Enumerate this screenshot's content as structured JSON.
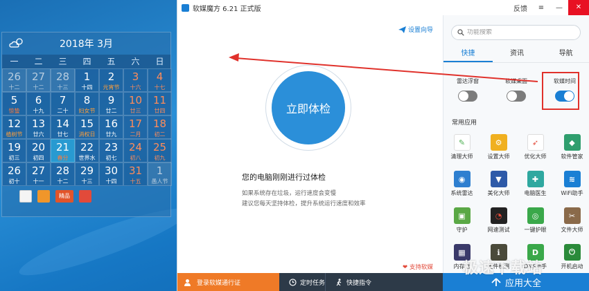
{
  "calendar": {
    "title": "2018年 3月",
    "weekdays": [
      "一",
      "二",
      "三",
      "四",
      "五",
      "六",
      "日"
    ],
    "days": [
      {
        "n": "26",
        "l": "十二",
        "dim": true
      },
      {
        "n": "27",
        "l": "十二",
        "dim": true
      },
      {
        "n": "28",
        "l": "十三",
        "dim": true
      },
      {
        "n": "1",
        "l": "十四"
      },
      {
        "n": "2",
        "l": "元宵节",
        "fest": true
      },
      {
        "n": "3",
        "l": "十六",
        "hol": true
      },
      {
        "n": "4",
        "l": "十七",
        "hol": true
      },
      {
        "n": "5",
        "l": "惊蛰",
        "fest2": true
      },
      {
        "n": "6",
        "l": "十九"
      },
      {
        "n": "7",
        "l": "二十"
      },
      {
        "n": "8",
        "l": "妇女节",
        "fest": true
      },
      {
        "n": "9",
        "l": "廿二"
      },
      {
        "n": "10",
        "l": "廿三",
        "hol": true
      },
      {
        "n": "11",
        "l": "廿四",
        "hol": true
      },
      {
        "n": "12",
        "l": "植树节",
        "fest": true
      },
      {
        "n": "13",
        "l": "廿六"
      },
      {
        "n": "14",
        "l": "廿七"
      },
      {
        "n": "15",
        "l": "消权日",
        "fest": true
      },
      {
        "n": "16",
        "l": "廿九"
      },
      {
        "n": "17",
        "l": "二月",
        "hol": true
      },
      {
        "n": "18",
        "l": "初二",
        "hol": true
      },
      {
        "n": "19",
        "l": "初三"
      },
      {
        "n": "20",
        "l": "初四"
      },
      {
        "n": "21",
        "l": "春分",
        "fest2": true,
        "today": true
      },
      {
        "n": "22",
        "l": "世界水"
      },
      {
        "n": "23",
        "l": "初七"
      },
      {
        "n": "24",
        "l": "初八",
        "hol": true
      },
      {
        "n": "25",
        "l": "初九",
        "hol": true
      },
      {
        "n": "26",
        "l": "初十"
      },
      {
        "n": "27",
        "l": "十一"
      },
      {
        "n": "28",
        "l": "十二"
      },
      {
        "n": "29",
        "l": "十三"
      },
      {
        "n": "30",
        "l": "十四"
      },
      {
        "n": "31",
        "l": "十五",
        "hol": true
      },
      {
        "n": "1",
        "l": "愚人节",
        "dim": true
      }
    ],
    "tools": [
      "notes-icon",
      "calendar-book-icon",
      "gift-icon",
      "toolbox-icon"
    ],
    "tool_badge": "精品"
  },
  "window": {
    "title": "软媒魔方 6.21 正式版",
    "feedback": "反馈",
    "menu_icon": "≡",
    "min_icon": "—",
    "close_icon": "✕"
  },
  "main": {
    "guide": "设置向导",
    "check_button": "立即体检",
    "msg_title": "您的电脑刚刚进行过体检",
    "msg1": "如果系统存在垃圾，运行速度会变慢",
    "msg2": "建议您每天坚持体检，提升系统运行速度和效率",
    "support": "支持软媒"
  },
  "side": {
    "search_placeholder": "功能搜索",
    "tabs": [
      "快捷",
      "资讯",
      "导航"
    ],
    "toggles": [
      {
        "label": "雷达浮窗",
        "on": false
      },
      {
        "label": "软媒桌面",
        "on": false
      },
      {
        "label": "软媒时间",
        "on": true
      }
    ],
    "apps_title": "常用应用",
    "apps": [
      {
        "label": "清理大师",
        "icon": "broom-icon",
        "color": "#ffffff",
        "fg": "#4caf50",
        "glyph": "✎"
      },
      {
        "label": "设置大师",
        "icon": "settings-gear-icon",
        "color": "#f0b020",
        "fg": "#fff",
        "glyph": "⚙"
      },
      {
        "label": "优化大师",
        "icon": "rocket-icon",
        "color": "#ffffff",
        "fg": "#e24a3a",
        "glyph": "➶"
      },
      {
        "label": "软件管家",
        "icon": "software-manager-icon",
        "color": "#2f9e6e",
        "fg": "#fff",
        "glyph": "◆"
      },
      {
        "label": "系统雷达",
        "icon": "radar-icon",
        "color": "#2e7fd0",
        "fg": "#fff",
        "glyph": "◉"
      },
      {
        "label": "美化大师",
        "icon": "tshirt-icon",
        "color": "#2e5aa8",
        "fg": "#fff",
        "glyph": "▼"
      },
      {
        "label": "电脑医生",
        "icon": "medical-kit-icon",
        "color": "#2fa8a0",
        "fg": "#fff",
        "glyph": "✚"
      },
      {
        "label": "WiFi助手",
        "icon": "wifi-icon",
        "color": "#1a7fd4",
        "fg": "#fff",
        "glyph": "≋"
      },
      {
        "label": "守护",
        "icon": "shield-icon",
        "color": "#5aa845",
        "fg": "#fff",
        "glyph": "▣"
      },
      {
        "label": "网速测试",
        "icon": "speedometer-icon",
        "color": "#222222",
        "fg": "#e24a3a",
        "glyph": "◔"
      },
      {
        "label": "一键护眼",
        "icon": "eye-icon",
        "color": "#3aa84a",
        "fg": "#fff",
        "glyph": "◎"
      },
      {
        "label": "文件大师",
        "icon": "file-master-icon",
        "color": "#8a6a4a",
        "fg": "#fff",
        "glyph": "✂"
      },
      {
        "label": "内存盘",
        "icon": "memory-chip-icon",
        "color": "#3a3a6a",
        "fg": "#fff",
        "glyph": "▦"
      },
      {
        "label": "硬件检测",
        "icon": "hardware-icon",
        "color": "#4a4a3a",
        "fg": "#fff",
        "glyph": "ℹ"
      },
      {
        "label": "DNS助手",
        "icon": "dns-icon",
        "color": "#3aa84a",
        "fg": "#fff",
        "glyph": "D"
      },
      {
        "label": "开机启动",
        "icon": "power-icon",
        "color": "#2a8a3a",
        "fg": "#fff",
        "glyph": "⏻"
      }
    ]
  },
  "bottom": {
    "login": "登录软媒通行证",
    "timer": "定时任务",
    "quick": "快捷指令",
    "all_apps": "应用大全"
  },
  "watermark": "极速下载站",
  "colors": {
    "accent": "#1a7fd4",
    "orange": "#ef7a27",
    "highlight": "#e0312b"
  }
}
